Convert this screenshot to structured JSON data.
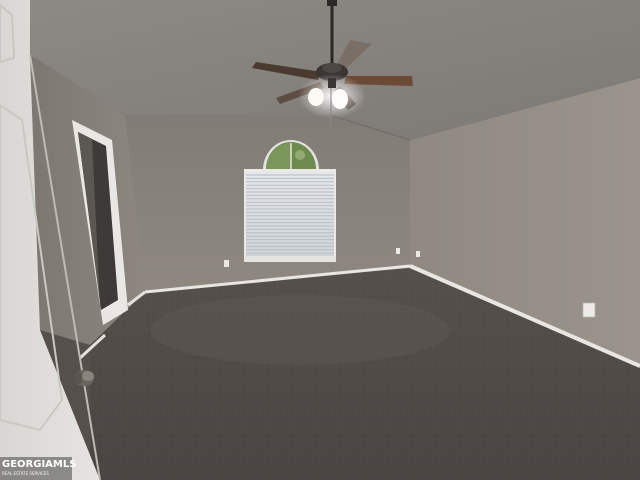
{
  "photo": {
    "subject": "empty bedroom with vaulted ceiling, ceiling fan with lights, arched window with blinds, carpet, open door",
    "colors": {
      "ceiling": "#8b8783",
      "back_wall": "#8c867f",
      "right_wall": "#928c85",
      "left_wall": "#8a857e",
      "carpet": "#4f4a47",
      "trim": "#e8e6e2",
      "door": "#e3e1dd",
      "window_light": "#d9dde2",
      "arch_glass": "#6e8a4f"
    }
  },
  "watermark": {
    "brand": "GEORGIAMLS",
    "tagline": "REAL ESTATE SERVICES"
  }
}
